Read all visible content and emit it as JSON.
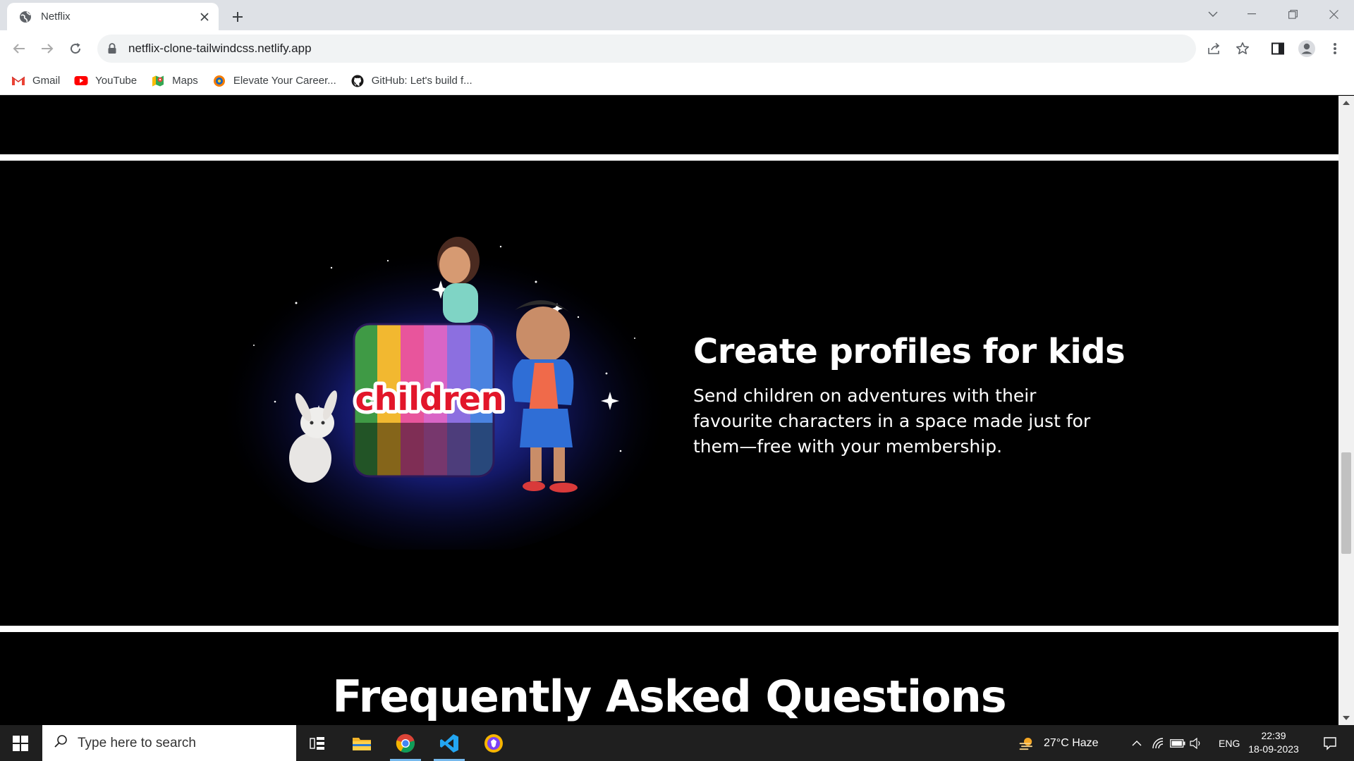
{
  "browser": {
    "tab": {
      "title": "Netflix"
    },
    "address_bar": {
      "url": "netflix-clone-tailwindcss.netlify.app"
    },
    "bookmarks": [
      {
        "label": "Gmail",
        "icon": "gmail-icon"
      },
      {
        "label": "YouTube",
        "icon": "youtube-icon"
      },
      {
        "label": "Maps",
        "icon": "maps-icon"
      },
      {
        "label": "Elevate Your Career...",
        "icon": "elevate-icon"
      },
      {
        "label": "GitHub: Let's build f...",
        "icon": "github-icon"
      }
    ]
  },
  "page": {
    "kids_section": {
      "title": "Create profiles for kids",
      "description": "Send children on adventures with their favourite characters in a space made just for them—free with your membership.",
      "image_text": "children"
    },
    "faq_section": {
      "title": "Frequently Asked Questions"
    }
  },
  "taskbar": {
    "search_placeholder": "Type here to search",
    "weather": "27°C Haze",
    "language": "ENG",
    "time": "22:39",
    "date": "18-09-2023"
  },
  "colors": {
    "page_bg": "#000000",
    "divider": "#ffffff",
    "taskbar_bg": "#1f1f1f",
    "chrome_tabbar": "#dee1e6"
  }
}
